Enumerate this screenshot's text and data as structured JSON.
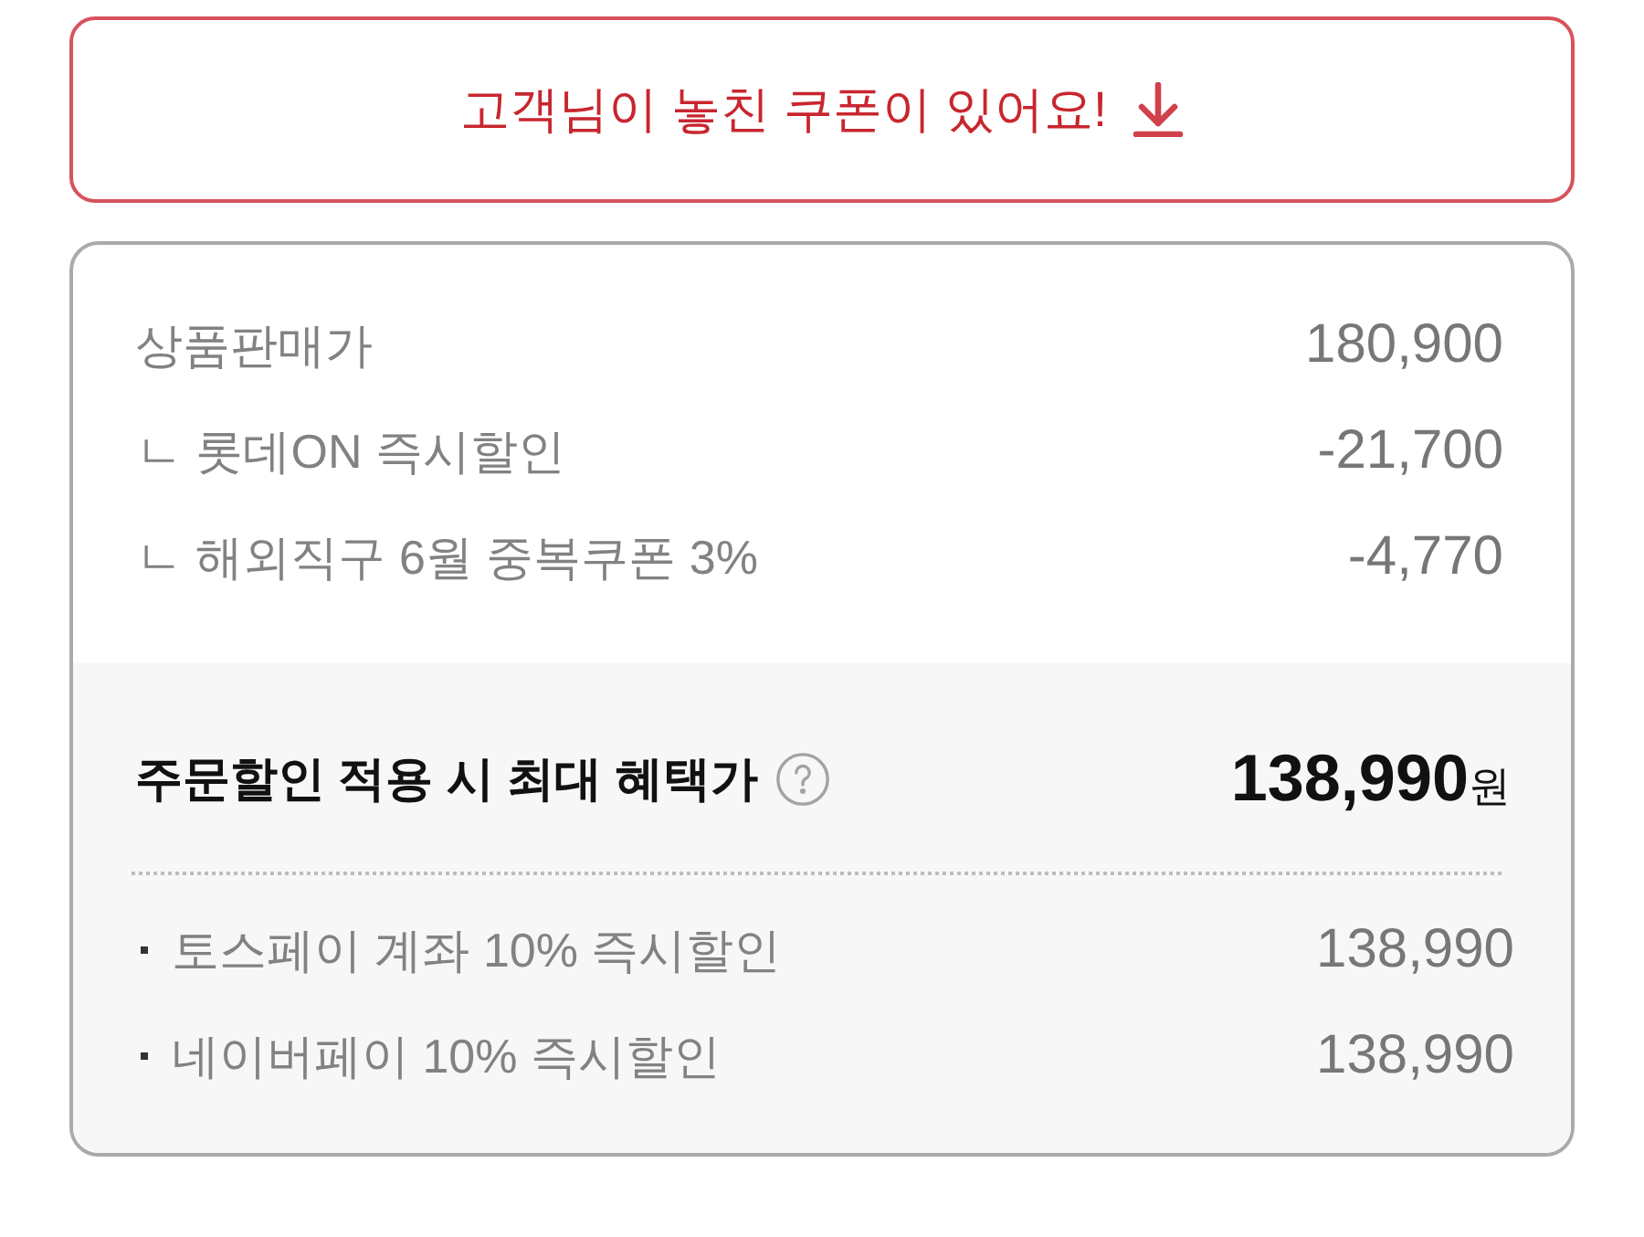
{
  "coupon_banner": {
    "label": "고객님이 놓친 쿠폰이 있어요!"
  },
  "price_breakdown": {
    "rows": [
      {
        "label": "상품판매가",
        "amount": "180,900"
      },
      {
        "label": "ㄴ 롯데ON 즉시할인",
        "amount": "-21,700"
      },
      {
        "label": "ㄴ 해외직구 6월 중복쿠폰 3%",
        "amount": "-4,770"
      }
    ]
  },
  "max_benefit": {
    "label": "주문할인 적용 시 최대 혜택가",
    "price": "**138,990**원",
    "payment_offers": [
      {
        "label": "토스페이 계좌 10% 즉시할인",
        "amount": "138,990"
      },
      {
        "label": "네이버페이 10% 즉시할인",
        "amount": "138,990"
      }
    ]
  }
}
